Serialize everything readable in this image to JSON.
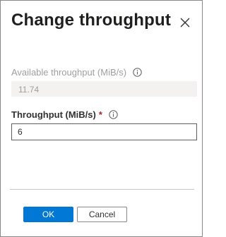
{
  "dialog": {
    "title": "Change throughput"
  },
  "fields": {
    "available": {
      "label": "Available throughput (MiB/s)",
      "value": "11.74"
    },
    "throughput": {
      "label": "Throughput (MiB/s)",
      "required_marker": "*",
      "value": "6"
    }
  },
  "footer": {
    "ok_label": "OK",
    "cancel_label": "Cancel"
  },
  "icons": {
    "close": "close-icon",
    "info": "info-icon"
  },
  "colors": {
    "primary": "#0078d4",
    "required": "#a4262c",
    "disabled_text": "#a19f9d"
  }
}
